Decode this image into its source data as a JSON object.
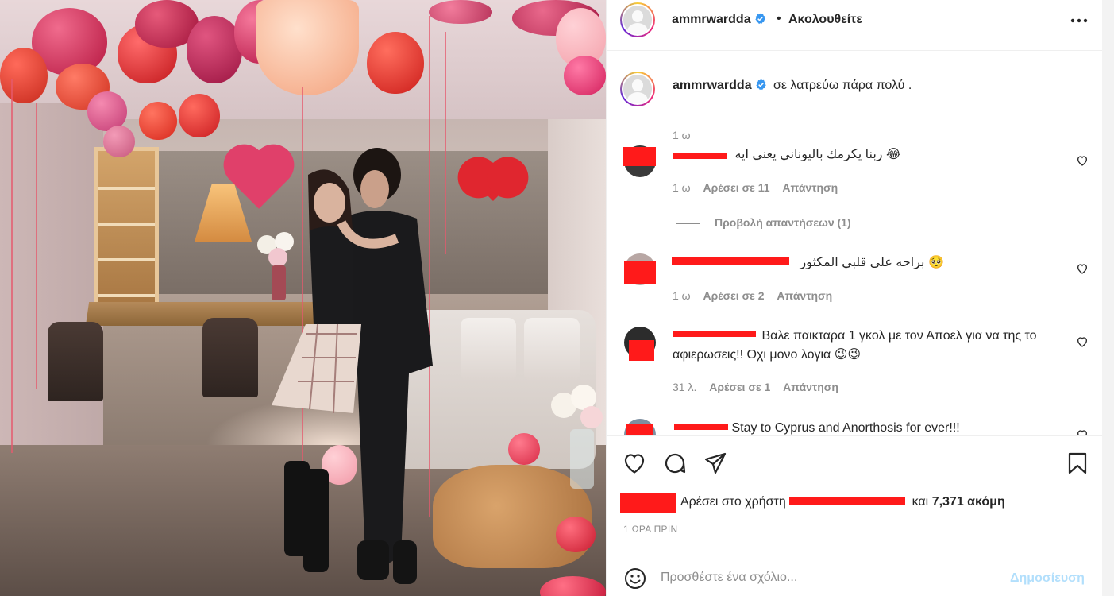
{
  "post": {
    "username": "ammrwardda",
    "header_separator": "•",
    "follow_status": "Ακολουθείτε",
    "caption_username": "ammrwardda",
    "caption_text": "σε λατρεύω πάρα πολύ .",
    "caption_time": "1 ω"
  },
  "comments": [
    {
      "text": "ربنا يكرمك باليوناني يعني ايه 😂",
      "time": "1 ω",
      "likes": "Αρέσει σε 11",
      "reply": "Απάντηση"
    },
    {
      "text": "براحه على قلبي المكثور 🥺",
      "time": "1 ω",
      "likes": "Αρέσει σε 2",
      "reply": "Απάντηση"
    },
    {
      "text": "Βαλε παικταρα 1 γκολ με τον Αποελ για να της το αφιερωσεις!! Οχι μονο λογια 😉😉",
      "time": "31 λ.",
      "likes": "Αρέσει σε 1",
      "reply": "Απάντηση"
    },
    {
      "text": "Stay to Cyprus and Anorthosis for ever!!!"
    }
  ],
  "replies_link": "Προβολή απαντήσεων (1)",
  "likes": {
    "prefix": "Αρέσει στο χρήστη",
    "conjunction": "και",
    "others": "7,371 ακόμη"
  },
  "time_ago": "1 ΩΡΑ ΠΡΙΝ",
  "composer": {
    "placeholder": "Προσθέστε ένα σχόλιο...",
    "post_label": "Δημοσίευση"
  },
  "icons": {
    "verified": "verified-badge-icon",
    "more": "more-options-icon",
    "heart": "heart-icon",
    "comment": "comment-icon",
    "share": "share-icon",
    "save": "bookmark-icon",
    "emoji": "emoji-icon"
  },
  "colors": {
    "verified_blue": "#3897f0",
    "meta_gray": "#8e8e8e",
    "post_button_disabled": "#b2dffc",
    "redaction_red": "#ff1a1a"
  }
}
